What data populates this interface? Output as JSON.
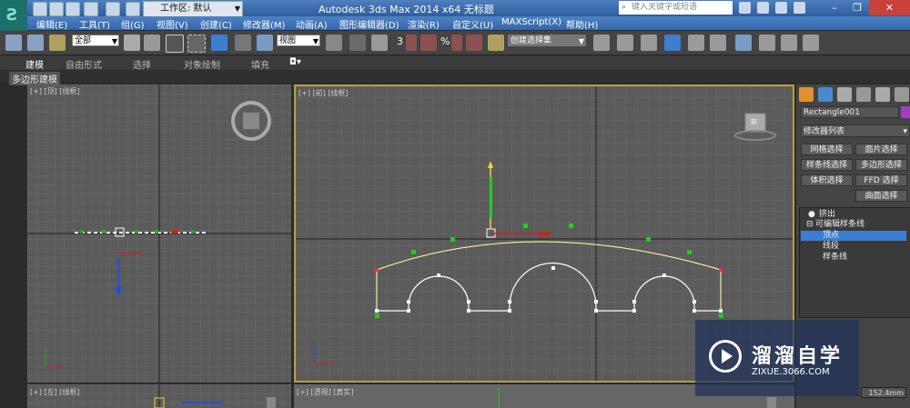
{
  "titlebar": {
    "workspace_label": "工作区: 默认",
    "title": "Autodesk 3ds Max  2014 x64     无标题",
    "search_placeholder": "键入关键字或短语"
  },
  "menu": [
    "编辑(E)",
    "工具(T)",
    "组(G)",
    "视图(V)",
    "创建(C)",
    "修改器(M)",
    "动画(A)",
    "图形编辑器(D)",
    "渲染(R)",
    "自定义(U)",
    "MAXScript(X)",
    "帮助(H)"
  ],
  "toolbar": {
    "filter_select": "全部",
    "refcoord_select": "视图",
    "named_selection": "创建选择集",
    "snap_value": "3",
    "percent_label": "%"
  },
  "ribbon": {
    "tabs": [
      "建模",
      "自由形式",
      "选择",
      "对象绘制",
      "填充"
    ],
    "subtab": "多边形建模"
  },
  "viewports": {
    "top_left": "[+] [顶] [线框]",
    "main": "[+] [前] [线框]",
    "bottom_left": "[+] [左] [线框]",
    "bottom_right": "[+] [透视] [真实]",
    "cube_label": "前"
  },
  "command_panel": {
    "object_name": "Rectangle001",
    "modifier_list": "修改器列表",
    "buttons": [
      "网格选择",
      "面片选择",
      "样条线选择",
      "多边形选择",
      "体积选择",
      "FFD 选择",
      "曲面选择"
    ],
    "stack": {
      "extrude": "挤出",
      "editable_spline": "可编辑样条线",
      "vertex": "顶点",
      "segment": "线段",
      "spline": "样条线"
    },
    "value": "152.4mm"
  },
  "watermark": {
    "title": "溜溜自学",
    "url": "ZIXUE.3066.COM"
  },
  "colors": {
    "titlebar": "#3a6db0",
    "active_border": "#b8a040",
    "selection_blue": "#3c7fd0",
    "spline_yellow": "#f0d040"
  }
}
